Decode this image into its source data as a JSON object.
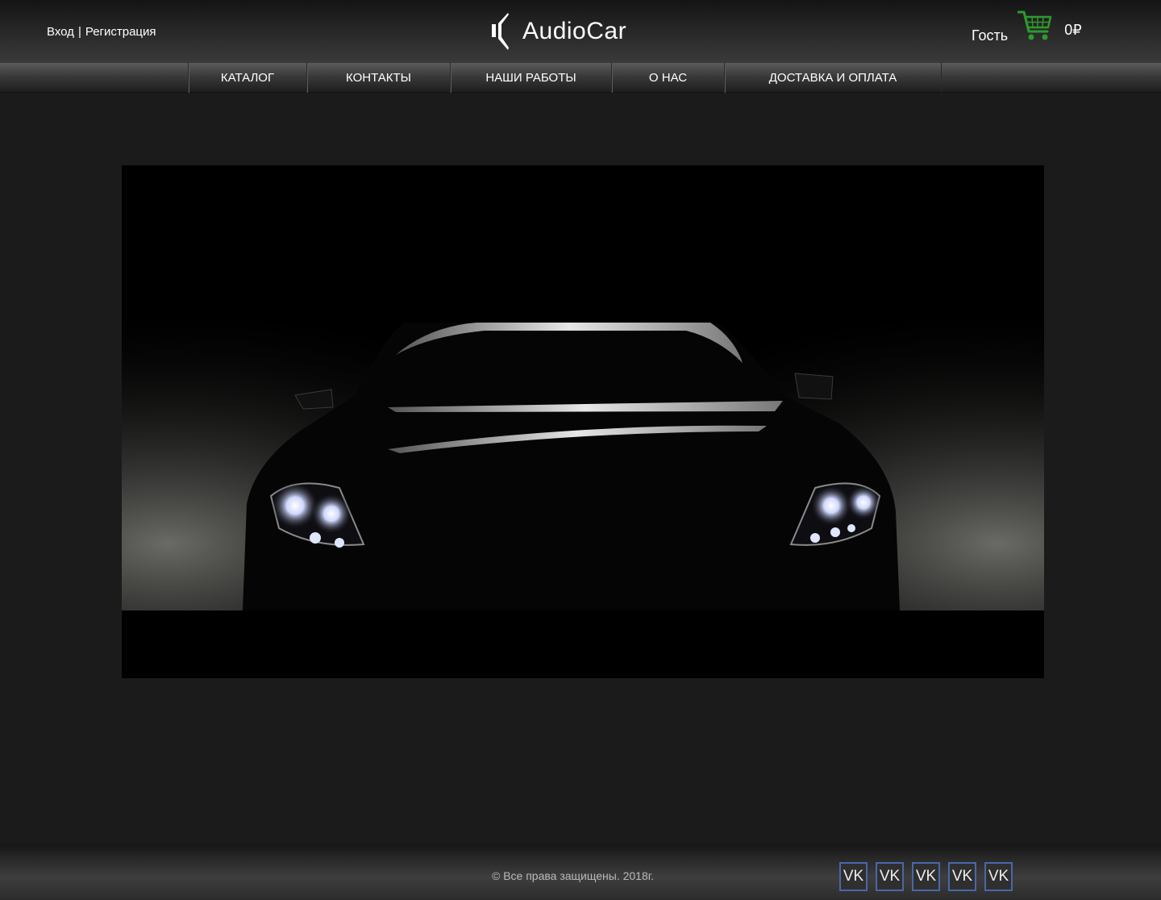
{
  "header": {
    "login_label": "Вход",
    "separator": "|",
    "register_label": "Регистрация",
    "logo_text": "AudioCar",
    "guest_label": "Гость",
    "cart_total": "0₽"
  },
  "nav": {
    "items": [
      {
        "label": "КАТАЛОГ"
      },
      {
        "label": "КОНТАКТЫ"
      },
      {
        "label": "НАШИ РАБОТЫ"
      },
      {
        "label": "О НАС"
      },
      {
        "label": "ДОСТАВКА И ОПЛАТА"
      }
    ]
  },
  "hero": {
    "image": "car-front-headlights-dark"
  },
  "footer": {
    "copyright": "© Все права защищены. 2018г.",
    "social": [
      {
        "label": "VK",
        "icon": "vk-icon"
      },
      {
        "label": "VK",
        "icon": "vk-icon"
      },
      {
        "label": "VK",
        "icon": "vk-icon"
      },
      {
        "label": "VK",
        "icon": "vk-icon"
      },
      {
        "label": "VK",
        "icon": "vk-icon"
      }
    ]
  },
  "colors": {
    "background": "#1b1b1b",
    "cart_green": "#2e9a2e",
    "vk_border": "#4a67a8"
  }
}
